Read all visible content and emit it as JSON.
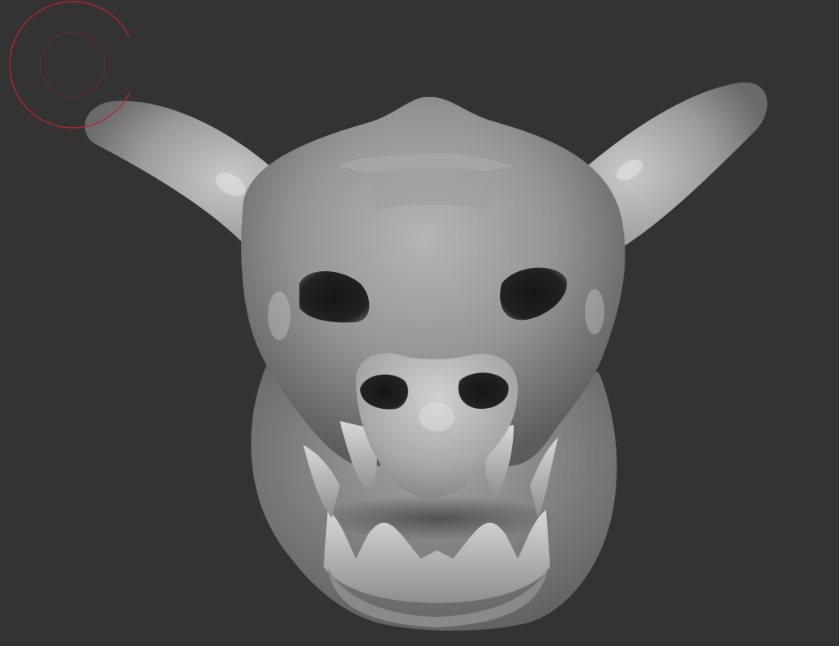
{
  "viewport": {
    "background": "#333333",
    "mesh_color": "#9a9a9a",
    "brush_outer_color": "#b8252b",
    "brush_inner_color": "#6a2a2d"
  },
  "model": {
    "icon": "sculpt-mesh-icon"
  },
  "brush": {
    "icon": "brush-circle-icon"
  }
}
